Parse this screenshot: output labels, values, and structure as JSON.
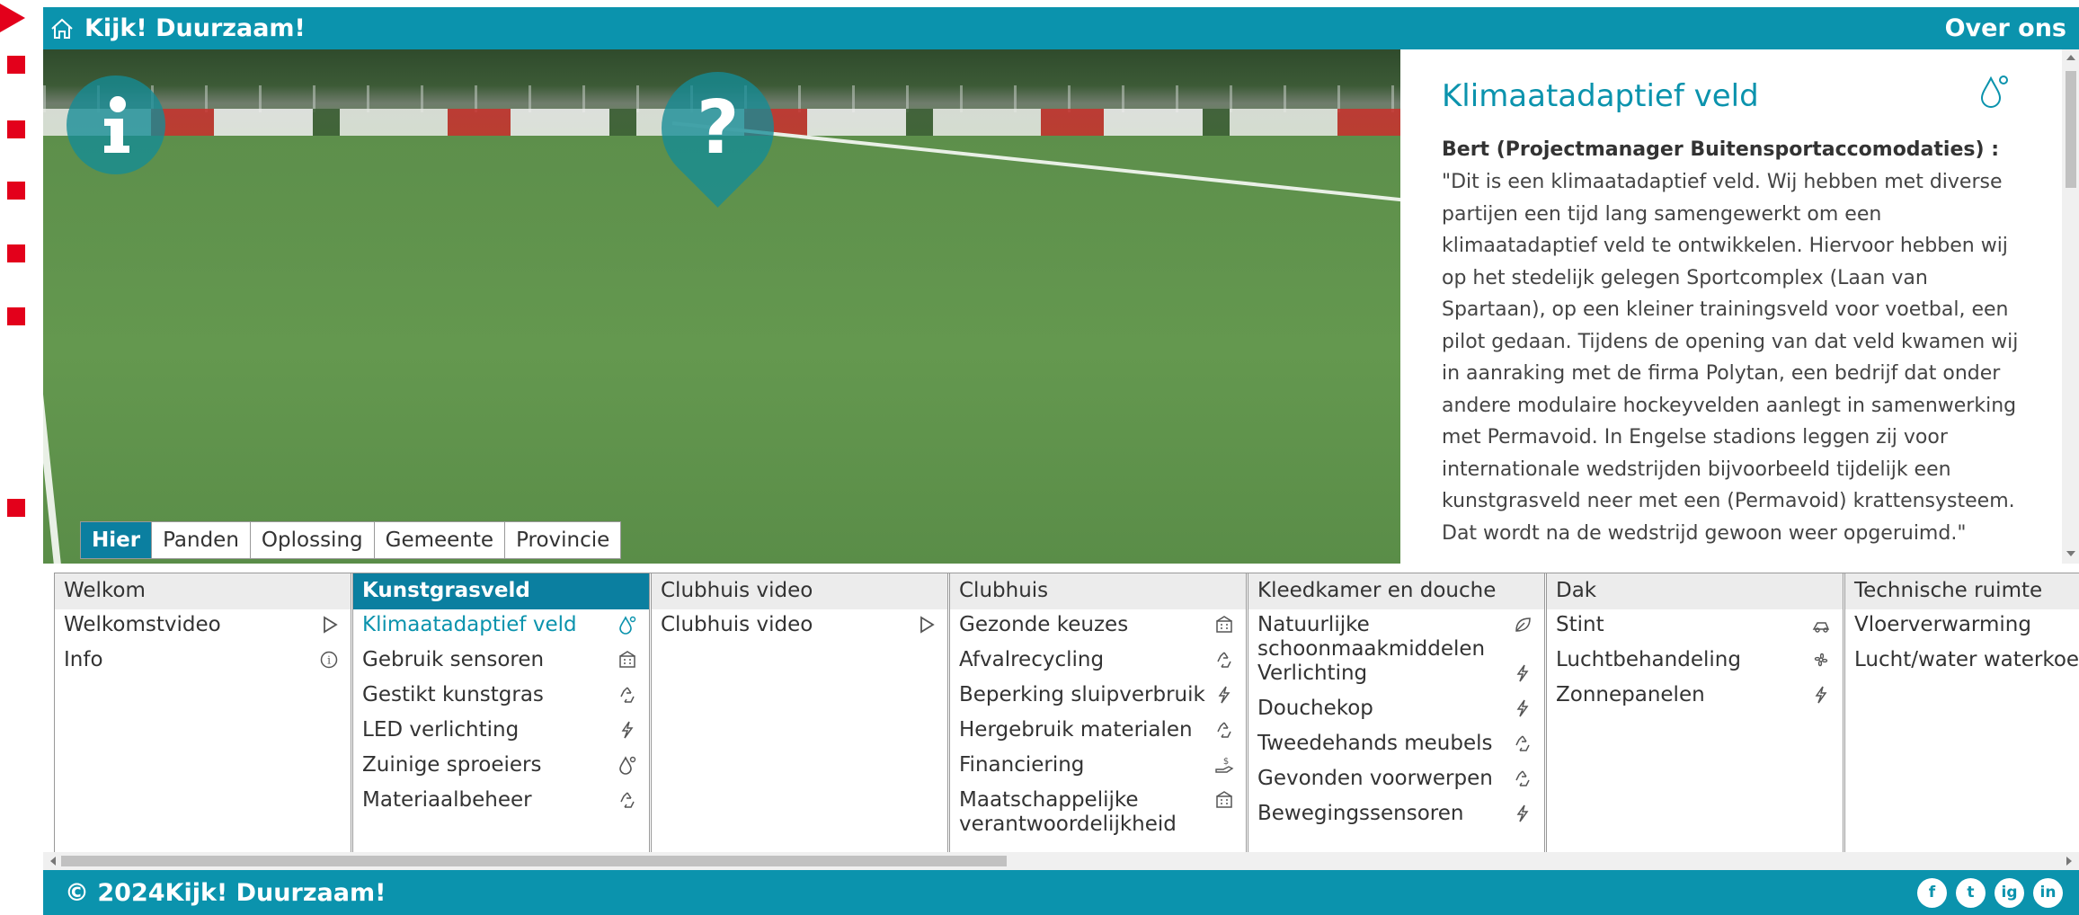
{
  "header": {
    "brand": "Kijk! Duurzaam!",
    "nav_over": "Over ons"
  },
  "photo": {
    "tabs": [
      "Hier",
      "Panden",
      "Oplossing",
      "Gemeente",
      "Provincie"
    ],
    "active_tab": "Hier"
  },
  "article": {
    "title": "Klimaatadaptief veld",
    "speaker": "Bert (Projectmanager Buitensportaccomodaties) :",
    "quote_lines": [
      "\"Dit is een klimaatadaptief veld. Wij hebben met diverse",
      "partijen een tijd lang samengewerkt om een",
      "klimaatadaptief veld te ontwikkelen. Hiervoor hebben wij",
      "op het stedelijk gelegen Sportcomplex (Laan van",
      "Spartaan), op een kleiner trainingsveld voor voetbal, een",
      "pilot gedaan. Tijdens de opening van dat veld kwamen wij",
      "in aanraking met de firma Polytan, een bedrijf dat onder",
      "andere modulaire hockeyvelden aanlegt in samenwerking",
      "met Permavoid. In Engelse stadions leggen zij voor",
      "internationale wedstrijden bijvoorbeeld tijdelijk een",
      "kunstgrasveld neer met een (Permavoid) krattensysteem.",
      "Dat wordt na de wedstrijd gewoon weer opgeruimd.\""
    ]
  },
  "menus": [
    {
      "title": "Welkom",
      "items": [
        {
          "label": "Welkomstvideo",
          "icon": "play"
        },
        {
          "label": "Info",
          "icon": "info"
        }
      ]
    },
    {
      "title": "Kunstgrasveld",
      "active": true,
      "items": [
        {
          "label": "Klimaatadaptief veld",
          "icon": "drop",
          "active": true
        },
        {
          "label": "Gebruik sensoren",
          "icon": "building"
        },
        {
          "label": "Gestikt kunstgras",
          "icon": "recycle"
        },
        {
          "label": "LED verlichting",
          "icon": "bolt"
        },
        {
          "label": "Zuinige sproeiers",
          "icon": "drop"
        },
        {
          "label": "Materiaalbeheer",
          "icon": "recycle"
        }
      ]
    },
    {
      "title": "Clubhuis video",
      "items": [
        {
          "label": "Clubhuis video",
          "icon": "play"
        }
      ]
    },
    {
      "title": "Clubhuis",
      "items": [
        {
          "label": "Gezonde keuzes",
          "icon": "building"
        },
        {
          "label": "Afvalrecycling",
          "icon": "recycle"
        },
        {
          "label": "Beperking sluipverbruik",
          "icon": "bolt"
        },
        {
          "label": "Hergebruik materialen",
          "icon": "recycle"
        },
        {
          "label": "Financiering",
          "icon": "hand"
        },
        {
          "label": "Maatschappelijke verantwoordelijkheid",
          "icon": "building"
        }
      ]
    },
    {
      "title": "Kleedkamer en douche",
      "items": [
        {
          "label": "Natuurlijke schoonmaakmiddelen",
          "icon": "leaf"
        },
        {
          "label": "Verlichting",
          "icon": "bolt"
        },
        {
          "label": "Douchekop",
          "icon": "bolt"
        },
        {
          "label": "Tweedehands meubels",
          "icon": "recycle"
        },
        {
          "label": "Gevonden voorwerpen",
          "icon": "recycle"
        },
        {
          "label": "Bewegingssensoren",
          "icon": "bolt"
        }
      ]
    },
    {
      "title": "Dak",
      "items": [
        {
          "label": "Stint",
          "icon": "car"
        },
        {
          "label": "Luchtbehandeling",
          "icon": "fan"
        },
        {
          "label": "Zonnepanelen",
          "icon": "bolt"
        }
      ]
    },
    {
      "title": "Technische ruimte",
      "items": [
        {
          "label": "Vloerverwarming",
          "icon": ""
        },
        {
          "label": "Lucht/water waterkoeler",
          "icon": ""
        }
      ]
    }
  ],
  "footer": {
    "copyright": "© 2024Kijk! Duurzaam!",
    "social": [
      "f",
      "t",
      "ig",
      "in"
    ]
  },
  "colors": {
    "primary": "#0b93ad",
    "active": "#0b7fa0",
    "marker": "#e3001b"
  }
}
